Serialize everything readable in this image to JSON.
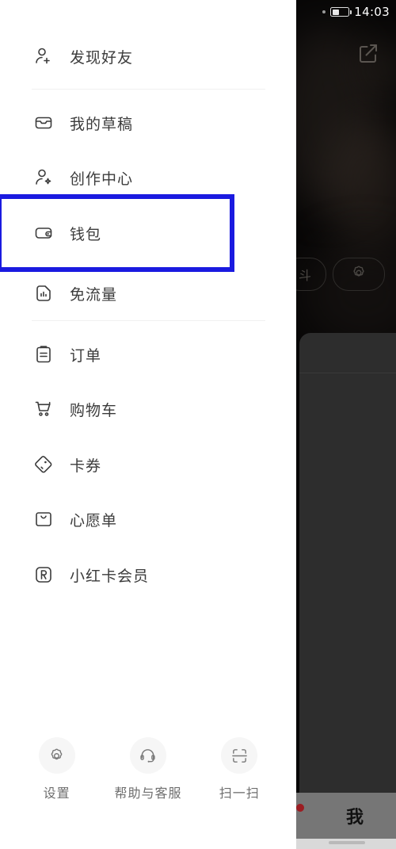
{
  "status_bar": {
    "time": "14:03",
    "battery_level_pct": 42
  },
  "background_app": {
    "external_link_icon": "external-link-icon",
    "pill_left_label": "斗",
    "pill_right_icon": "gear-icon",
    "bottom_nav_label": "我"
  },
  "drawer": {
    "groups": [
      {
        "items": [
          {
            "icon": "add-friend-icon",
            "label": "发现好友"
          }
        ]
      },
      {
        "items": [
          {
            "icon": "drafts-inbox-icon",
            "label": "我的草稿"
          },
          {
            "icon": "creator-center-icon",
            "label": "创作中心"
          },
          {
            "icon": "wallet-icon",
            "label": "钱包"
          },
          {
            "icon": "sim-data-icon",
            "label": "免流量"
          }
        ]
      },
      {
        "items": [
          {
            "icon": "clipboard-order-icon",
            "label": "订单"
          },
          {
            "icon": "shopping-cart-icon",
            "label": "购物车"
          },
          {
            "icon": "coupon-tag-icon",
            "label": "卡券"
          },
          {
            "icon": "wishlist-bag-icon",
            "label": "心愿单"
          },
          {
            "icon": "membership-r-icon",
            "label": "小红卡会员"
          }
        ]
      }
    ],
    "toolbar": [
      {
        "icon": "gear-icon",
        "label": "设置"
      },
      {
        "icon": "headset-support-icon",
        "label": "帮助与客服"
      },
      {
        "icon": "scan-qr-icon",
        "label": "扫一扫"
      }
    ]
  },
  "annotation": {
    "highlight_target_label": "钱包",
    "highlight_color": "#1a1ae0"
  }
}
